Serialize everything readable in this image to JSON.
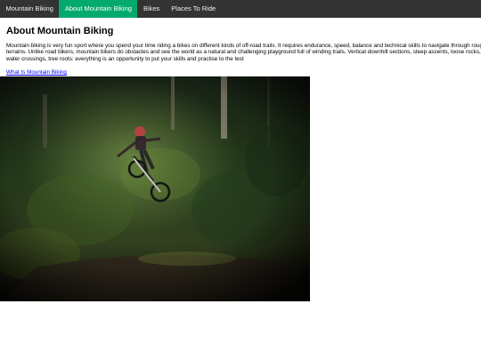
{
  "nav": {
    "items": [
      {
        "label": "Mountain Biking",
        "active": false
      },
      {
        "label": "About Mountain Biking",
        "active": true
      },
      {
        "label": "Bikes",
        "active": false
      },
      {
        "label": "Places To Ride",
        "active": false
      }
    ]
  },
  "main": {
    "title": "About Mountain Biking",
    "paragraph": "Mountain biking is very fun sport where you spend your time riding a bikes on different kinds of off-road trails. It requires endurance, speed, balance and technical skills to navigate through rough terrains. Unlike road bikers, mountain bikers do obstacles and see the world as a natural and challenging playground full of winding trails. Vertical downhill sections, steep ascents, loose rocks, water crossings, tree roots: everything is an opportunity to put your skills and practise to the test",
    "link_text": "What Is Mountain Biking"
  },
  "colors": {
    "nav_bg": "#333333",
    "nav_active": "#04aa6d",
    "link": "#0000ee"
  }
}
